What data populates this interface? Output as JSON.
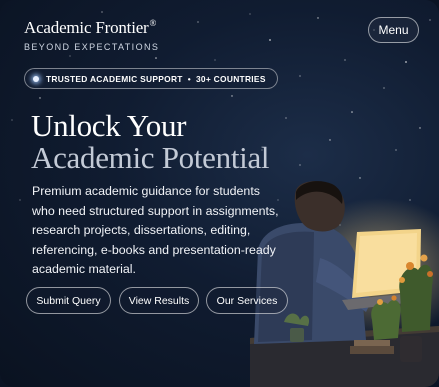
{
  "header": {
    "brand_name": "Academic Frontier",
    "brand_mark": "®",
    "tagline": "BEYOND EXPECTATIONS",
    "menu_label": "Menu"
  },
  "badge": {
    "icon": "glow-dot-icon",
    "part1": "TRUSTED ACADEMIC SUPPORT",
    "separator": "•",
    "part2": "30+ COUNTRIES"
  },
  "hero": {
    "title_line1": "Unlock Your",
    "title_line2": "Academic Potential",
    "description_lines": [
      "Premium academic guidance for students",
      "who need structured support in assignments,",
      "research projects, dissertations, editing,",
      "referencing, e-books and presentation-ready",
      "academic material."
    ]
  },
  "actions": {
    "submit_query": "Submit Query",
    "view_results": "View Results",
    "our_services": "Our Services"
  },
  "colors": {
    "background": "#101c31",
    "text": "#ffffff",
    "muted_title": "#c3cad6",
    "laptop_glow": "#f3d48a"
  }
}
